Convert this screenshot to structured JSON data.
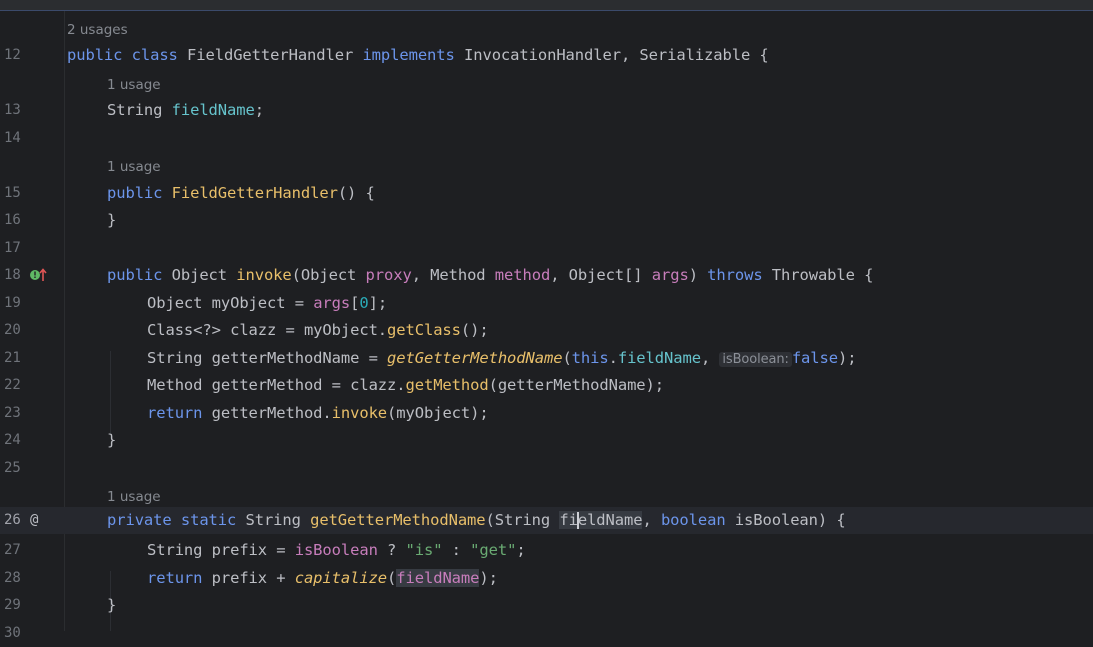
{
  "editor": {
    "usages": {
      "class": "2 usages",
      "field": "1 usage",
      "ctor": "1 usage",
      "getter": "1 usage"
    },
    "lines": {
      "l12": {
        "num": "12",
        "t1": "public ",
        "t2": "class ",
        "t3": "FieldGetterHandler ",
        "t4": "implements ",
        "t5": "InvocationHandler, Serializable {"
      },
      "l13": {
        "num": "13",
        "t1": "String ",
        "t2": "fieldName",
        "t3": ";"
      },
      "l14": {
        "num": "14"
      },
      "l15": {
        "num": "15",
        "t1": "public ",
        "t2": "FieldGetterHandler",
        "t3": "() {"
      },
      "l16": {
        "num": "16",
        "t1": "}"
      },
      "l17": {
        "num": "17"
      },
      "l18": {
        "num": "18",
        "t1": "public ",
        "t2": "Object ",
        "t3": "invoke",
        "t4": "(Object ",
        "t5": "proxy",
        "t6": ", Method ",
        "t7": "method",
        "t8": ", Object[] ",
        "t9": "args",
        "t10": ") ",
        "t11": "throws ",
        "t12": "Throwable {"
      },
      "l19": {
        "num": "19",
        "t1": "Object myObject = ",
        "t2": "args",
        "t3": "[",
        "t4": "0",
        "t5": "];"
      },
      "l20": {
        "num": "20",
        "t1": "Class<?> clazz = myObject.",
        "t2": "getClass",
        "t3": "();"
      },
      "l21": {
        "num": "21",
        "t1": "String getterMethodName = ",
        "t2": "getGetterMethodName",
        "t3": "(",
        "t4": "this",
        "t5": ".",
        "t6": "fieldName",
        "t7": ", ",
        "hint": "isBoolean:",
        "t8": "false",
        "t9": ");"
      },
      "l22": {
        "num": "22",
        "t1": "Method getterMethod = clazz.",
        "t2": "getMethod",
        "t3": "(getterMethodName);"
      },
      "l23": {
        "num": "23",
        "t1": "return ",
        "t2": "getterMethod.",
        "t3": "invoke",
        "t4": "(myObject);"
      },
      "l24": {
        "num": "24",
        "t1": "}"
      },
      "l25": {
        "num": "25"
      },
      "l26": {
        "num": "26",
        "t1": "private ",
        "t2": "static ",
        "t3": "String ",
        "t4": "getGetterMethodName",
        "t5": "(String ",
        "t6a": "fi",
        "t6b": "eldName",
        "t7": ", ",
        "t8": "boolean ",
        "t9": "isBoolean",
        "t10": ") {"
      },
      "l27": {
        "num": "27",
        "t1": "String prefix = ",
        "t2": "isBoolean",
        "t3": " ? ",
        "t4": "\"is\"",
        "t5": " : ",
        "t6": "\"get\"",
        "t7": ";"
      },
      "l28": {
        "num": "28",
        "t1": "return ",
        "t2": "prefix + ",
        "t3": "capitalize",
        "t4": "(",
        "t5": "fieldName",
        "t6": ");"
      },
      "l29": {
        "num": "29",
        "t1": "}"
      },
      "l30": {
        "num": "30"
      }
    },
    "gutter_icons": {
      "l18": "implements-method-icon",
      "l26": "annotation-at-icon"
    }
  }
}
